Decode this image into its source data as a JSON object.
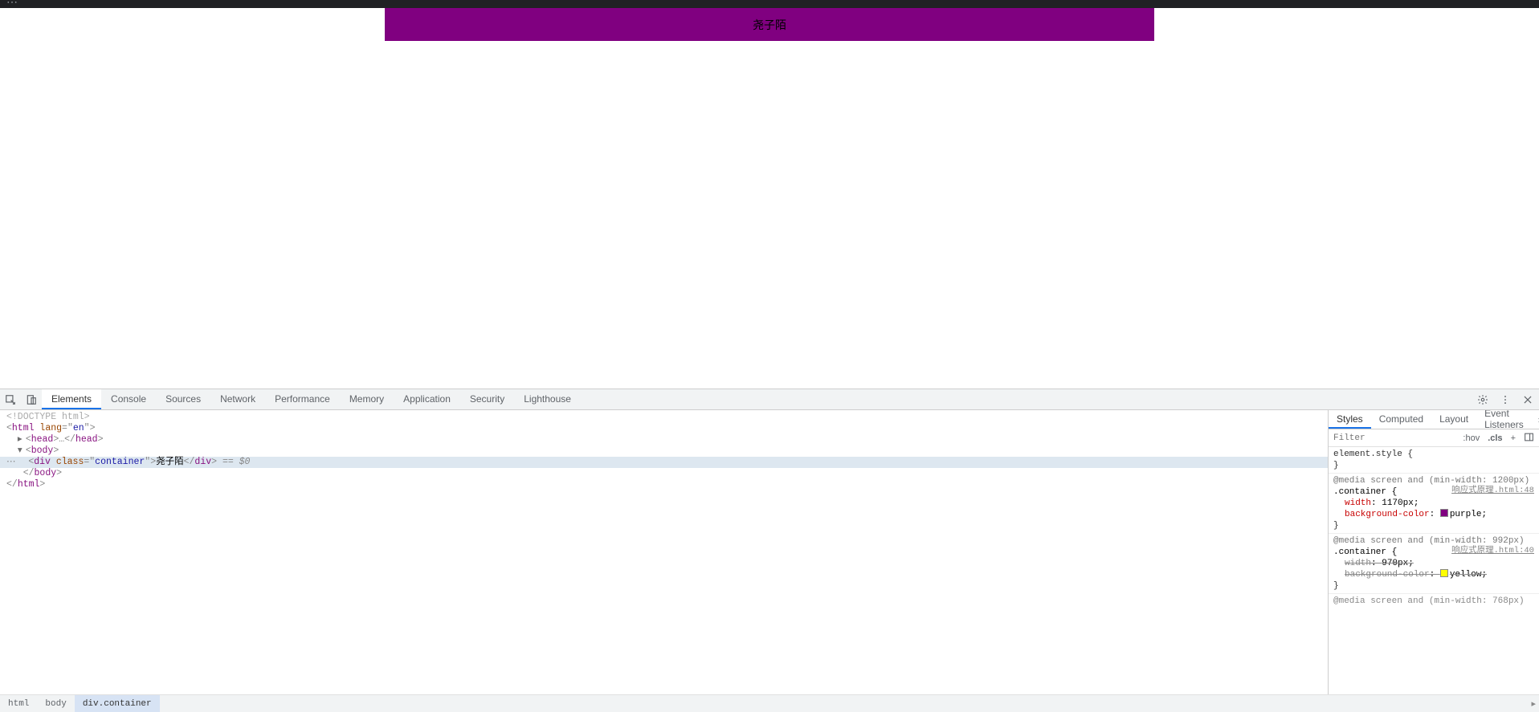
{
  "browser": {
    "content_text": "尧子陌"
  },
  "devtools": {
    "tabs": [
      "Elements",
      "Console",
      "Sources",
      "Network",
      "Performance",
      "Memory",
      "Application",
      "Security",
      "Lighthouse"
    ],
    "active_tab_index": 0
  },
  "dom": {
    "line0": "<!DOCTYPE html>",
    "html_open": {
      "tag": "html",
      "attr": "lang",
      "val": "en"
    },
    "head_tag": "head",
    "body_tag": "body",
    "div_tag": "div",
    "div_attr": "class",
    "div_val": "container",
    "div_text": "尧子陌",
    "eqdollar": "== $0",
    "ellipsis": "…"
  },
  "breadcrumbs": [
    "html",
    "body",
    "div.container"
  ],
  "styles": {
    "tabs": [
      "Styles",
      "Computed",
      "Layout",
      "Event Listeners"
    ],
    "active_tab_index": 0,
    "filter_placeholder": "Filter",
    "hov": ":hov",
    "cls": ".cls",
    "plus": "+",
    "element_style": "element.style {",
    "close_brace": "}",
    "rule1": {
      "media": "@media screen and (min-width: 1200px)",
      "selector": ".container",
      "src": "响应式原理.html:48",
      "p1": {
        "name": "width",
        "value": "1170px"
      },
      "p2": {
        "name": "background-color",
        "value": "purple",
        "swatch": "#800080"
      }
    },
    "rule2": {
      "media": "@media screen and (min-width: 992px)",
      "selector": ".container",
      "src": "响应式原理.html:40",
      "p1": {
        "name": "width",
        "value": "970px"
      },
      "p2": {
        "name": "background-color",
        "value": "yellow",
        "swatch": "#ffff00"
      }
    },
    "rule3_hint": "@media screen and (min-width: 768px)"
  }
}
